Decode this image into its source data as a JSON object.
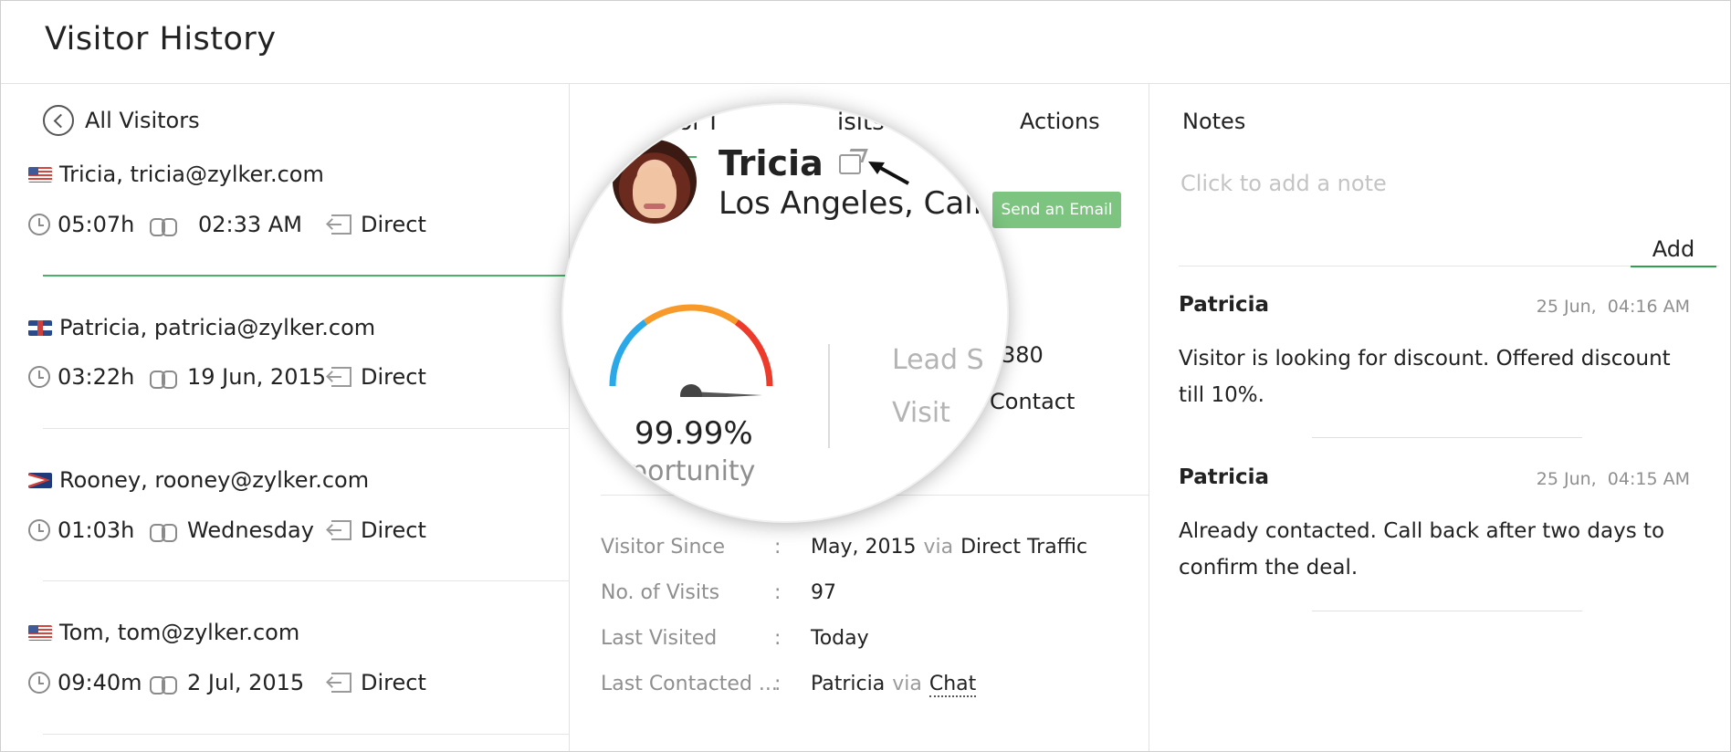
{
  "page": {
    "title": "Visitor History"
  },
  "left": {
    "back_label": "All Visitors",
    "visitors": [
      {
        "name": "Tricia, tricia@zylker.com",
        "flag": "us-flag",
        "duration": "05:07h",
        "last_seen": "02:33 AM",
        "source": "Direct",
        "active": true
      },
      {
        "name": "Patricia, patricia@zylker.com",
        "flag": "uk-flag",
        "duration": "03:22h",
        "last_seen": "19 Jun, 2015",
        "source": "Direct",
        "active": false
      },
      {
        "name": "Rooney, rooney@zylker.com",
        "flag": "american-samoa-flag",
        "duration": "01:03h",
        "last_seen": "Wednesday",
        "source": "Direct",
        "active": false
      },
      {
        "name": "Tom, tom@zylker.com",
        "flag": "us-flag",
        "duration": "09:40m",
        "last_seen": "2 Jul, 2015",
        "source": "Direct",
        "active": false
      }
    ]
  },
  "middle": {
    "tabs": [
      {
        "label": "Visitor Info",
        "visible_text": "Visitor I"
      },
      {
        "label": "Visits",
        "visible_text": "isits"
      },
      {
        "label": "Actions"
      }
    ],
    "send_email_label": "Send an Email",
    "partial": {
      "lead_value": "380",
      "contact_label": "Contact"
    },
    "info": [
      {
        "label": "Visitor Since",
        "value": "May, 2015",
        "via": "via",
        "extra": "Direct Traffic"
      },
      {
        "label": "No. of Visits",
        "value": "97"
      },
      {
        "label": "Last Visited",
        "value": "Today"
      },
      {
        "label": "Last Contacted ...",
        "value": "Patricia",
        "via": "via",
        "extra": "Chat"
      }
    ],
    "colon": ":"
  },
  "lens": {
    "tab_a": "Visitor I",
    "tab_b": "isits",
    "name": "Tricia",
    "location": "Los Angeles, Cali",
    "score_percent": "99.99%",
    "score_fraction": 0.9999,
    "opportunity_label": "pportunity",
    "lead_label": "Lead S",
    "visit_label": "Visit"
  },
  "notes": {
    "title": "Notes",
    "placeholder": "Click to add a note",
    "add_label": "Add",
    "items": [
      {
        "author": "Patricia",
        "time": "25 Jun,  04:16 AM",
        "text": "Visitor is looking for discount. Offered discount till 10%."
      },
      {
        "author": "Patricia",
        "time": "25 Jun,  04:15 AM",
        "text": "Already contacted. Call back after two days to confirm the deal."
      }
    ]
  },
  "colors": {
    "accent_green": "#4caf6a",
    "button_green": "#7cc47f",
    "gauge_blue": "#2aa8e8",
    "gauge_orange": "#f79a2a",
    "gauge_red": "#ee3a2a"
  }
}
